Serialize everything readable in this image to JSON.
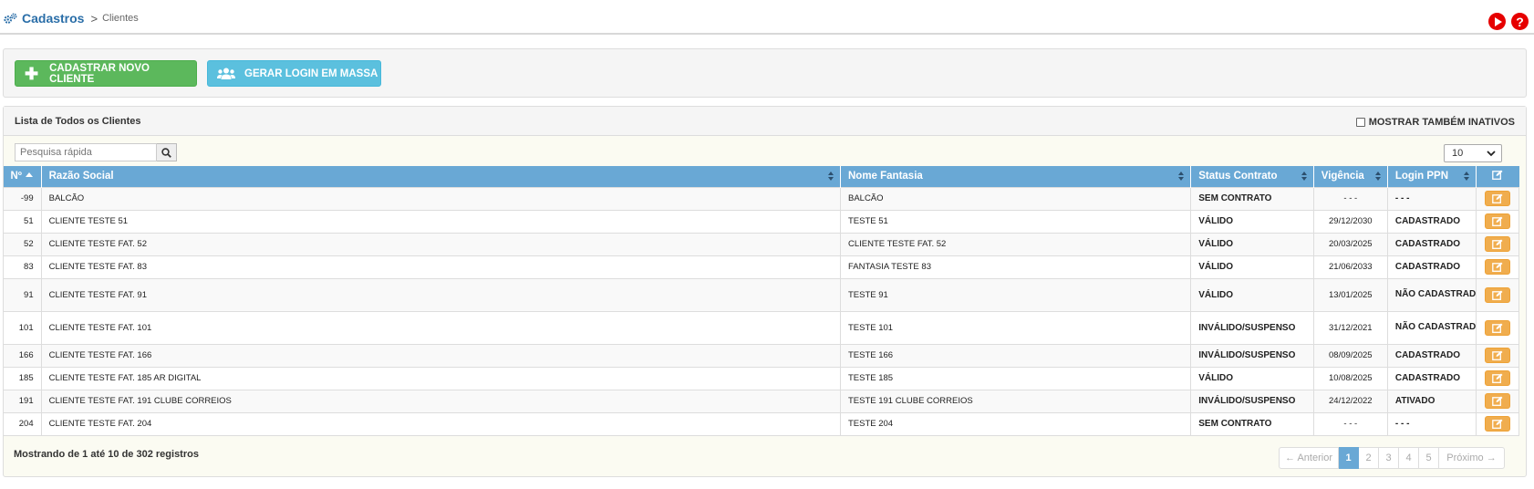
{
  "header": {
    "section": "Cadastros",
    "separator": ">",
    "current": "Clientes",
    "icons": [
      "gears-icon",
      "play-icon",
      "help-icon"
    ],
    "help_label": "?"
  },
  "actions": {
    "new_client_label": "CADASTRAR NOVO CLIENTE",
    "mass_login_label": "GERAR LOGIN EM MASSA",
    "new_client_color": "#5cb85c",
    "mass_login_color": "#5bc0de"
  },
  "list": {
    "title": "Lista de Todos os Clientes",
    "show_inactive_label": "MOSTRAR TAMBÉM INATIVOS",
    "search_placeholder": "Pesquisa rápida",
    "per_page": "10",
    "columns": [
      "Nº",
      "Razão Social",
      "Nome Fantasia",
      "Status Contrato",
      "Vigência",
      "Login PPN"
    ],
    "rows": [
      {
        "num": "-99",
        "razao": "BALCÃO",
        "fantasia": "BALCÃO",
        "status": "SEM CONTRATO",
        "status_type": "none",
        "vigencia": "- - -",
        "login": "- - -",
        "login_type": "dash"
      },
      {
        "num": "51",
        "razao": "CLIENTE TESTE 51",
        "fantasia": "TESTE 51",
        "status": "VÁLIDO",
        "status_type": "ok",
        "vigencia": "29/12/2030",
        "login": "CADASTRADO",
        "login_type": "cad"
      },
      {
        "num": "52",
        "razao": "CLIENTE TESTE FAT. 52",
        "fantasia": "CLIENTE TESTE FAT. 52",
        "status": "VÁLIDO",
        "status_type": "ok",
        "vigencia": "20/03/2025",
        "login": "CADASTRADO",
        "login_type": "cad"
      },
      {
        "num": "83",
        "razao": "CLIENTE TESTE FAT. 83",
        "fantasia": "FANTASIA TESTE 83",
        "status": "VÁLIDO",
        "status_type": "ok",
        "vigencia": "21/06/2033",
        "login": "CADASTRADO",
        "login_type": "cad"
      },
      {
        "num": "91",
        "razao": "CLIENTE TESTE FAT. 91",
        "fantasia": "TESTE 91",
        "status": "VÁLIDO",
        "status_type": "ok",
        "vigencia": "13/01/2025",
        "login": "NÃO CADASTRADO",
        "login_type": "nao"
      },
      {
        "num": "101",
        "razao": "CLIENTE TESTE FAT. 101",
        "fantasia": "TESTE 101",
        "status": "INVÁLIDO/SUSPENSO",
        "status_type": "bad",
        "vigencia": "31/12/2021",
        "login": "NÃO CADASTRADO",
        "login_type": "nao"
      },
      {
        "num": "166",
        "razao": "CLIENTE TESTE FAT. 166",
        "fantasia": "TESTE 166",
        "status": "INVÁLIDO/SUSPENSO",
        "status_type": "bad",
        "vigencia": "08/09/2025",
        "login": "CADASTRADO",
        "login_type": "cad"
      },
      {
        "num": "185",
        "razao": "CLIENTE TESTE FAT. 185 AR DIGITAL",
        "fantasia": "TESTE 185",
        "status": "VÁLIDO",
        "status_type": "ok",
        "vigencia": "10/08/2025",
        "login": "CADASTRADO",
        "login_type": "cad"
      },
      {
        "num": "191",
        "razao": "CLIENTE TESTE FAT. 191 CLUBE CORREIOS",
        "fantasia": "TESTE 191 CLUBE CORREIOS",
        "status": "INVÁLIDO/SUSPENSO",
        "status_type": "bad",
        "vigencia": "24/12/2022",
        "login": "ATIVADO",
        "login_type": "atv"
      },
      {
        "num": "204",
        "razao": "CLIENTE TESTE FAT. 204",
        "fantasia": "TESTE 204",
        "status": "SEM CONTRATO",
        "status_type": "none",
        "vigencia": "- - -",
        "login": "- - -",
        "login_type": "dash"
      }
    ],
    "status_colors": {
      "ok": "#158a15",
      "bad": "#e0102a",
      "none": "#b8b8b8"
    },
    "showing": "Mostrando de 1 até 10 de 302 registros",
    "pagination": {
      "prev": "← Anterior",
      "pages": [
        "1",
        "2",
        "3",
        "4",
        "5"
      ],
      "active": "1",
      "next": "Próximo →"
    }
  }
}
